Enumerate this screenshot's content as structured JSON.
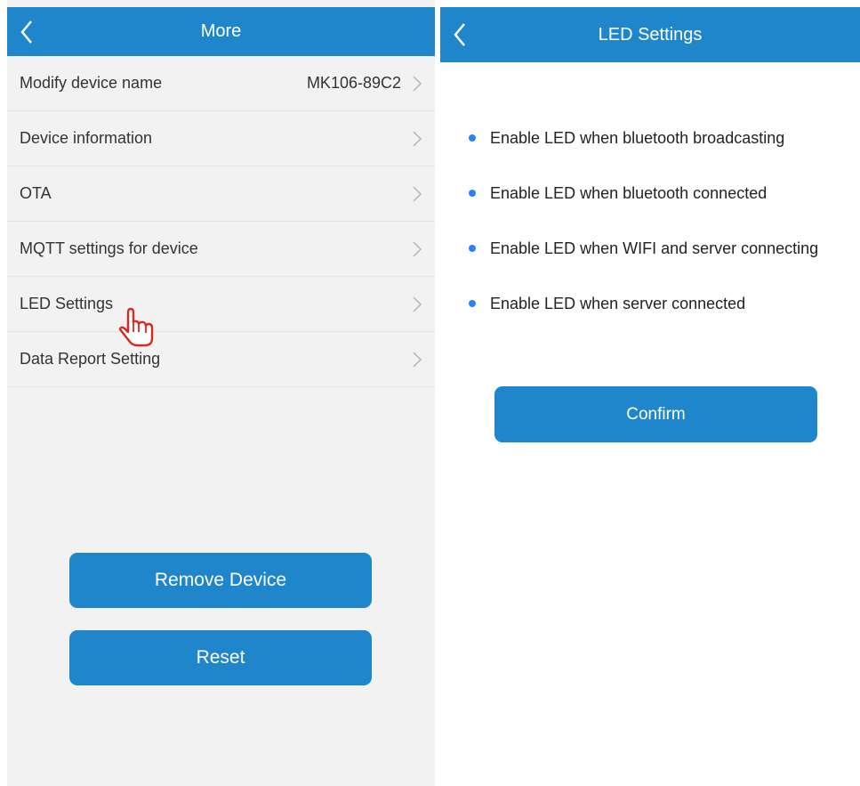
{
  "left": {
    "title": "More",
    "rows": [
      {
        "label": "Modify device name",
        "value": "MK106-89C2"
      },
      {
        "label": "Device information",
        "value": ""
      },
      {
        "label": "OTA",
        "value": ""
      },
      {
        "label": "MQTT settings for device",
        "value": ""
      },
      {
        "label": "LED Settings",
        "value": ""
      },
      {
        "label": "Data Report Setting",
        "value": ""
      }
    ],
    "remove_label": "Remove Device",
    "reset_label": "Reset"
  },
  "right": {
    "title": "LED Settings",
    "options": [
      "Enable LED when bluetooth broadcasting",
      "Enable LED when bluetooth connected",
      "Enable LED when WIFI and server connecting",
      "Enable LED when server connected"
    ],
    "confirm_label": "Confirm"
  },
  "colors": {
    "accent": "#1f86cc",
    "dot": "#2d82f0",
    "cursor": "#d9291c"
  },
  "icons": {
    "back": "chevron-left-icon",
    "row_arrow": "chevron-right-icon",
    "pointer": "hand-pointer-icon"
  }
}
